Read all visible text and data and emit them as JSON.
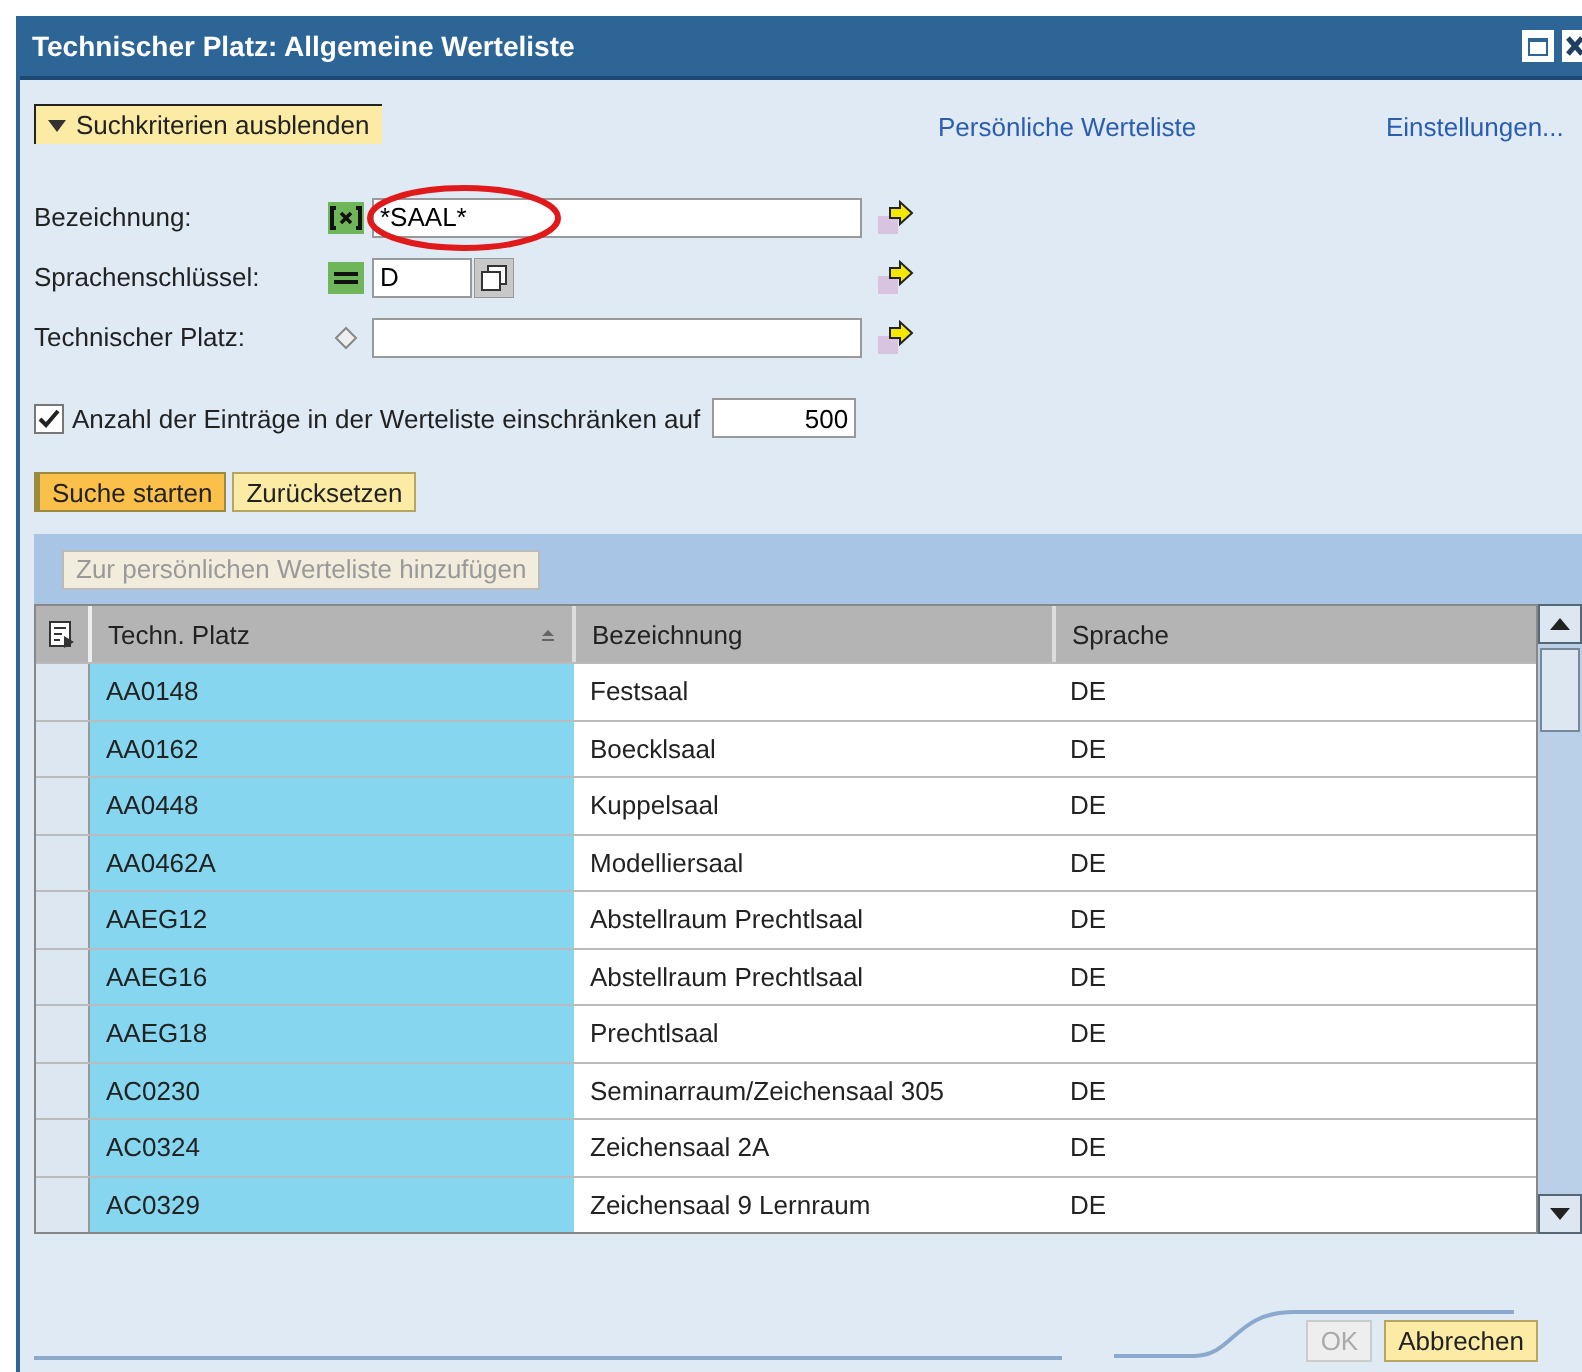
{
  "window": {
    "title": "Technischer Platz: Allgemeine Werteliste"
  },
  "criteria_toggle": {
    "label": "Suchkriterien ausblenden",
    "expanded": true
  },
  "links": [
    "Persönliche Werteliste",
    "Einstellungen..."
  ],
  "fields": [
    {
      "label": "Bezeichnung:",
      "kind": "contains",
      "value": "*SAAL*",
      "value_help": false,
      "highlighted": true
    },
    {
      "label": "Sprachenschlüssel:",
      "kind": "equals",
      "value": "D",
      "value_help": true,
      "highlighted": false
    },
    {
      "label": "Technischer Platz:",
      "kind": "none",
      "value_help": false,
      "highlighted": false
    }
  ],
  "limit": {
    "checked": true,
    "label": "Anzahl der Einträge in der Werteliste einschränken auf",
    "value": "500"
  },
  "actions": [
    {
      "label": "Suche starten",
      "primary": true
    },
    {
      "label": "Zurücksetzen",
      "primary": false
    }
  ],
  "table": {
    "toolbar_button": {
      "label": "Zur persönlichen Werteliste hinzufügen",
      "disabled": true
    },
    "columns": [
      {
        "label": "Techn. Platz",
        "sorted": true,
        "key": true
      },
      {
        "label": "Bezeichnung",
        "sorted": false,
        "key": false
      },
      {
        "label": "Sprache",
        "sorted": false,
        "key": false
      }
    ],
    "rows": [
      [
        "AA0148",
        "Festsaal",
        "DE"
      ],
      [
        "AA0162",
        "Boecklsaal",
        "DE"
      ],
      [
        "AA0448",
        "Kuppelsaal",
        "DE"
      ],
      [
        "AA0462A",
        "Modelliersaal",
        "DE"
      ],
      [
        "AAEG12",
        "Abstellraum Prechtlsaal",
        "DE"
      ],
      [
        "AAEG16",
        "Abstellraum Prechtlsaal",
        "DE"
      ],
      [
        "AAEG18",
        "Prechtlsaal",
        "DE"
      ],
      [
        "AC0230",
        "Seminarraum/Zeichensaal 305",
        "DE"
      ],
      [
        "AC0324",
        "Zeichensaal 2A",
        "DE"
      ],
      [
        "AC0329",
        "Zeichensaal 9 Lernraum",
        "DE"
      ]
    ]
  },
  "footer_buttons": [
    {
      "label": "OK",
      "disabled": true
    },
    {
      "label": "Abbrechen",
      "disabled": false
    }
  ]
}
